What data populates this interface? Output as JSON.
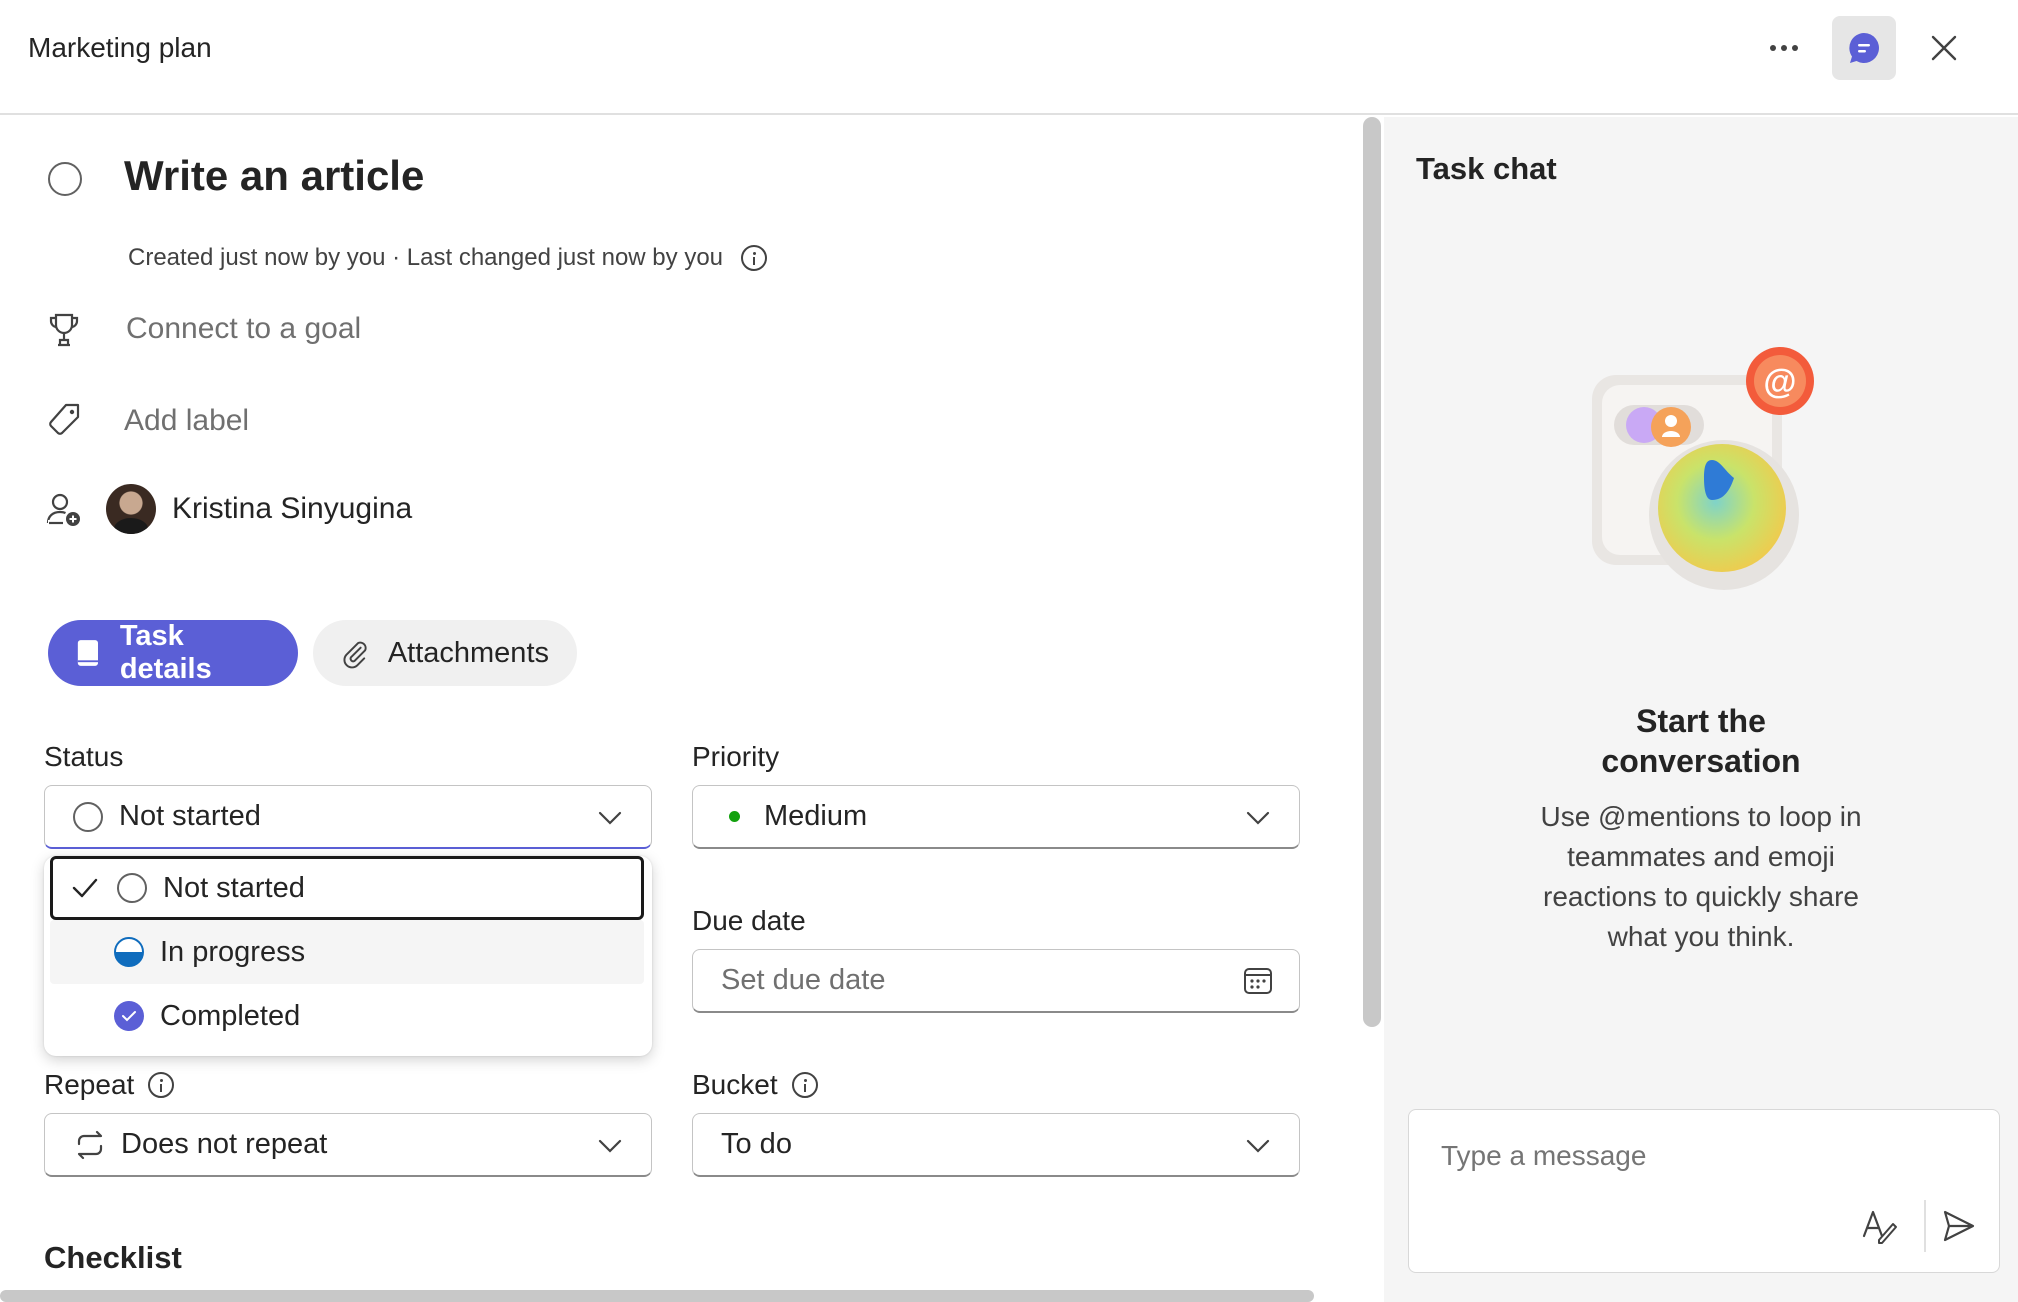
{
  "header": {
    "title": "Marketing plan",
    "more_icon": "more-horizontal-icon",
    "chat_icon": "chat-icon",
    "close_icon": "close-icon"
  },
  "task": {
    "title": "Write an article",
    "meta": "Created just now by you · Last changed just now by you",
    "goal_placeholder": "Connect to a goal",
    "label_placeholder": "Add label",
    "assignee": "Kristina Sinyugina"
  },
  "tabs": [
    {
      "label": "Task details",
      "active": true,
      "icon": "notebook-icon"
    },
    {
      "label": "Attachments",
      "active": false,
      "icon": "paperclip-icon"
    }
  ],
  "fields": {
    "status": {
      "label": "Status",
      "value": "Not started"
    },
    "priority": {
      "label": "Priority",
      "value": "Medium",
      "dot_color": "#13a10e"
    },
    "due_date": {
      "label": "Due date",
      "placeholder": "Set due date"
    },
    "repeat": {
      "label": "Repeat",
      "value": "Does not repeat"
    },
    "bucket": {
      "label": "Bucket",
      "value": "To do"
    }
  },
  "status_menu": [
    {
      "label": "Not started",
      "selected": true,
      "icon": "circle-icon"
    },
    {
      "label": "In progress",
      "selected": false,
      "icon": "half-circle-icon"
    },
    {
      "label": "Completed",
      "selected": false,
      "icon": "checkmark-circle-icon"
    }
  ],
  "checklist": {
    "title": "Checklist"
  },
  "chat": {
    "title": "Task chat",
    "start_title_line1": "Start the",
    "start_title_line2": "conversation",
    "description": "Use @mentions to loop in teammates and emoji reactions to quickly share what you think.",
    "input_placeholder": "Type a message"
  },
  "colors": {
    "accent": "#5b5fd6",
    "in_progress": "#0f6cbd",
    "medium_priority": "#13a10e"
  }
}
